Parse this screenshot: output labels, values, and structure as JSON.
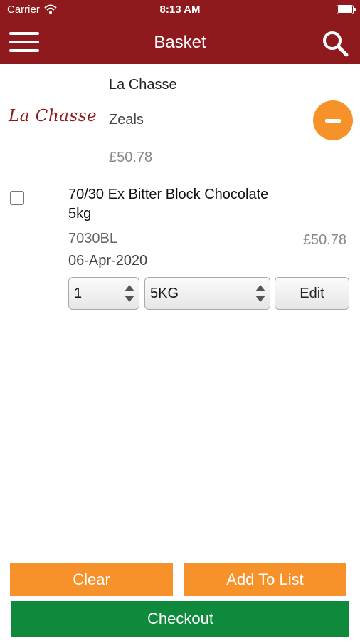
{
  "status_bar": {
    "carrier": "Carrier",
    "time": "8:13 AM"
  },
  "nav": {
    "title": "Basket"
  },
  "supplier": {
    "name": "La Chasse",
    "logo_text": "La Chasse",
    "location": "Zeals",
    "total": "£50.78"
  },
  "item": {
    "name": "70/30 Ex Bitter Block Chocolate 5kg",
    "code": "7030BL",
    "date": "06-Apr-2020",
    "price": "£50.78",
    "quantity": "1",
    "unit": "5KG",
    "edit_label": "Edit",
    "checked": false
  },
  "actions": {
    "clear_label": "Clear",
    "add_to_list_label": "Add To List",
    "checkout_label": "Checkout"
  },
  "colors": {
    "brand": "#8e1a1d",
    "accent": "#f7922b",
    "checkout": "#0f8a3d"
  },
  "icons": [
    "wifi-icon",
    "battery-icon",
    "menu-icon",
    "search-icon",
    "minus-icon",
    "stepper-arrows-icon"
  ]
}
